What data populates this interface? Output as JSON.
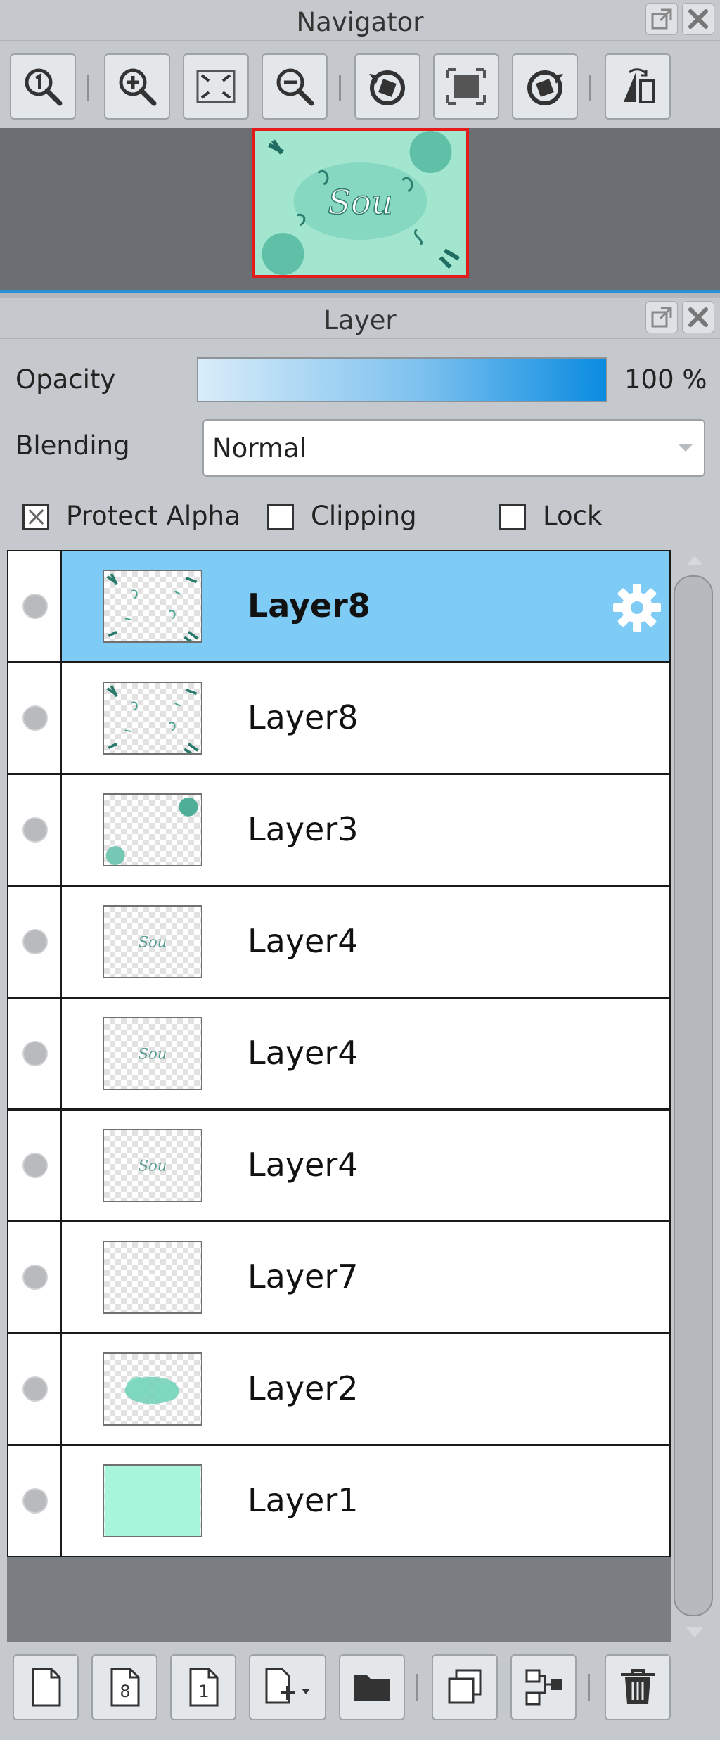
{
  "navigator": {
    "title": "Navigator",
    "toolbar": [
      {
        "name": "zoom-actual-button",
        "icon": "zoom-1-icon"
      },
      {
        "name": "zoom-in-button",
        "icon": "zoom-in-icon"
      },
      {
        "name": "fit-window-button",
        "icon": "fit-screen-icon"
      },
      {
        "name": "zoom-out-button",
        "icon": "zoom-out-icon"
      },
      {
        "name": "rotate-left-button",
        "icon": "rotate-left-icon"
      },
      {
        "name": "reset-rotation-button",
        "icon": "reset-rotation-icon"
      },
      {
        "name": "rotate-right-button",
        "icon": "rotate-right-icon"
      },
      {
        "name": "flip-horizontal-button",
        "icon": "flip-icon"
      }
    ],
    "preview_text": "Sou"
  },
  "layer_panel": {
    "title": "Layer",
    "opacity_label": "Opacity",
    "opacity_value": "100 %",
    "opacity_level": 1.0,
    "blending_label": "Blending",
    "blending_value": "Normal",
    "protect_alpha_label": "Protect Alpha",
    "protect_alpha_checked": true,
    "clipping_label": "Clipping",
    "clipping_checked": false,
    "lock_label": "Lock",
    "lock_checked": false,
    "layers": [
      {
        "name": "Layer8",
        "selected": true,
        "thumb": "frame"
      },
      {
        "name": "Layer8",
        "selected": false,
        "thumb": "frame"
      },
      {
        "name": "Layer3",
        "selected": false,
        "thumb": "balloons"
      },
      {
        "name": "Layer4",
        "selected": false,
        "thumb": "text"
      },
      {
        "name": "Layer4",
        "selected": false,
        "thumb": "text"
      },
      {
        "name": "Layer4",
        "selected": false,
        "thumb": "text"
      },
      {
        "name": "Layer7",
        "selected": false,
        "thumb": "blank"
      },
      {
        "name": "Layer2",
        "selected": false,
        "thumb": "cloud"
      },
      {
        "name": "Layer1",
        "selected": false,
        "thumb": "fill"
      }
    ],
    "bottom_toolbar": [
      {
        "name": "new-color-layer-button",
        "icon": "page-icon"
      },
      {
        "name": "new-8bit-layer-button",
        "icon": "page-8-icon",
        "label": "8"
      },
      {
        "name": "new-1bit-layer-button",
        "icon": "page-1-icon",
        "label": "1"
      },
      {
        "name": "add-layer-dropdown-button",
        "icon": "add-page-icon"
      },
      {
        "name": "new-folder-button",
        "icon": "folder-icon"
      },
      {
        "name": "duplicate-layer-button",
        "icon": "duplicate-icon"
      },
      {
        "name": "merge-down-button",
        "icon": "merge-icon"
      },
      {
        "name": "delete-layer-button",
        "icon": "trash-icon"
      }
    ]
  },
  "colors": {
    "panel_bg": "#c5c9cd",
    "selected_row": "#7ecbf6",
    "accent_blue": "#2a8fd6",
    "preview_border": "#e31b1b",
    "mint": "#a7f5da"
  }
}
